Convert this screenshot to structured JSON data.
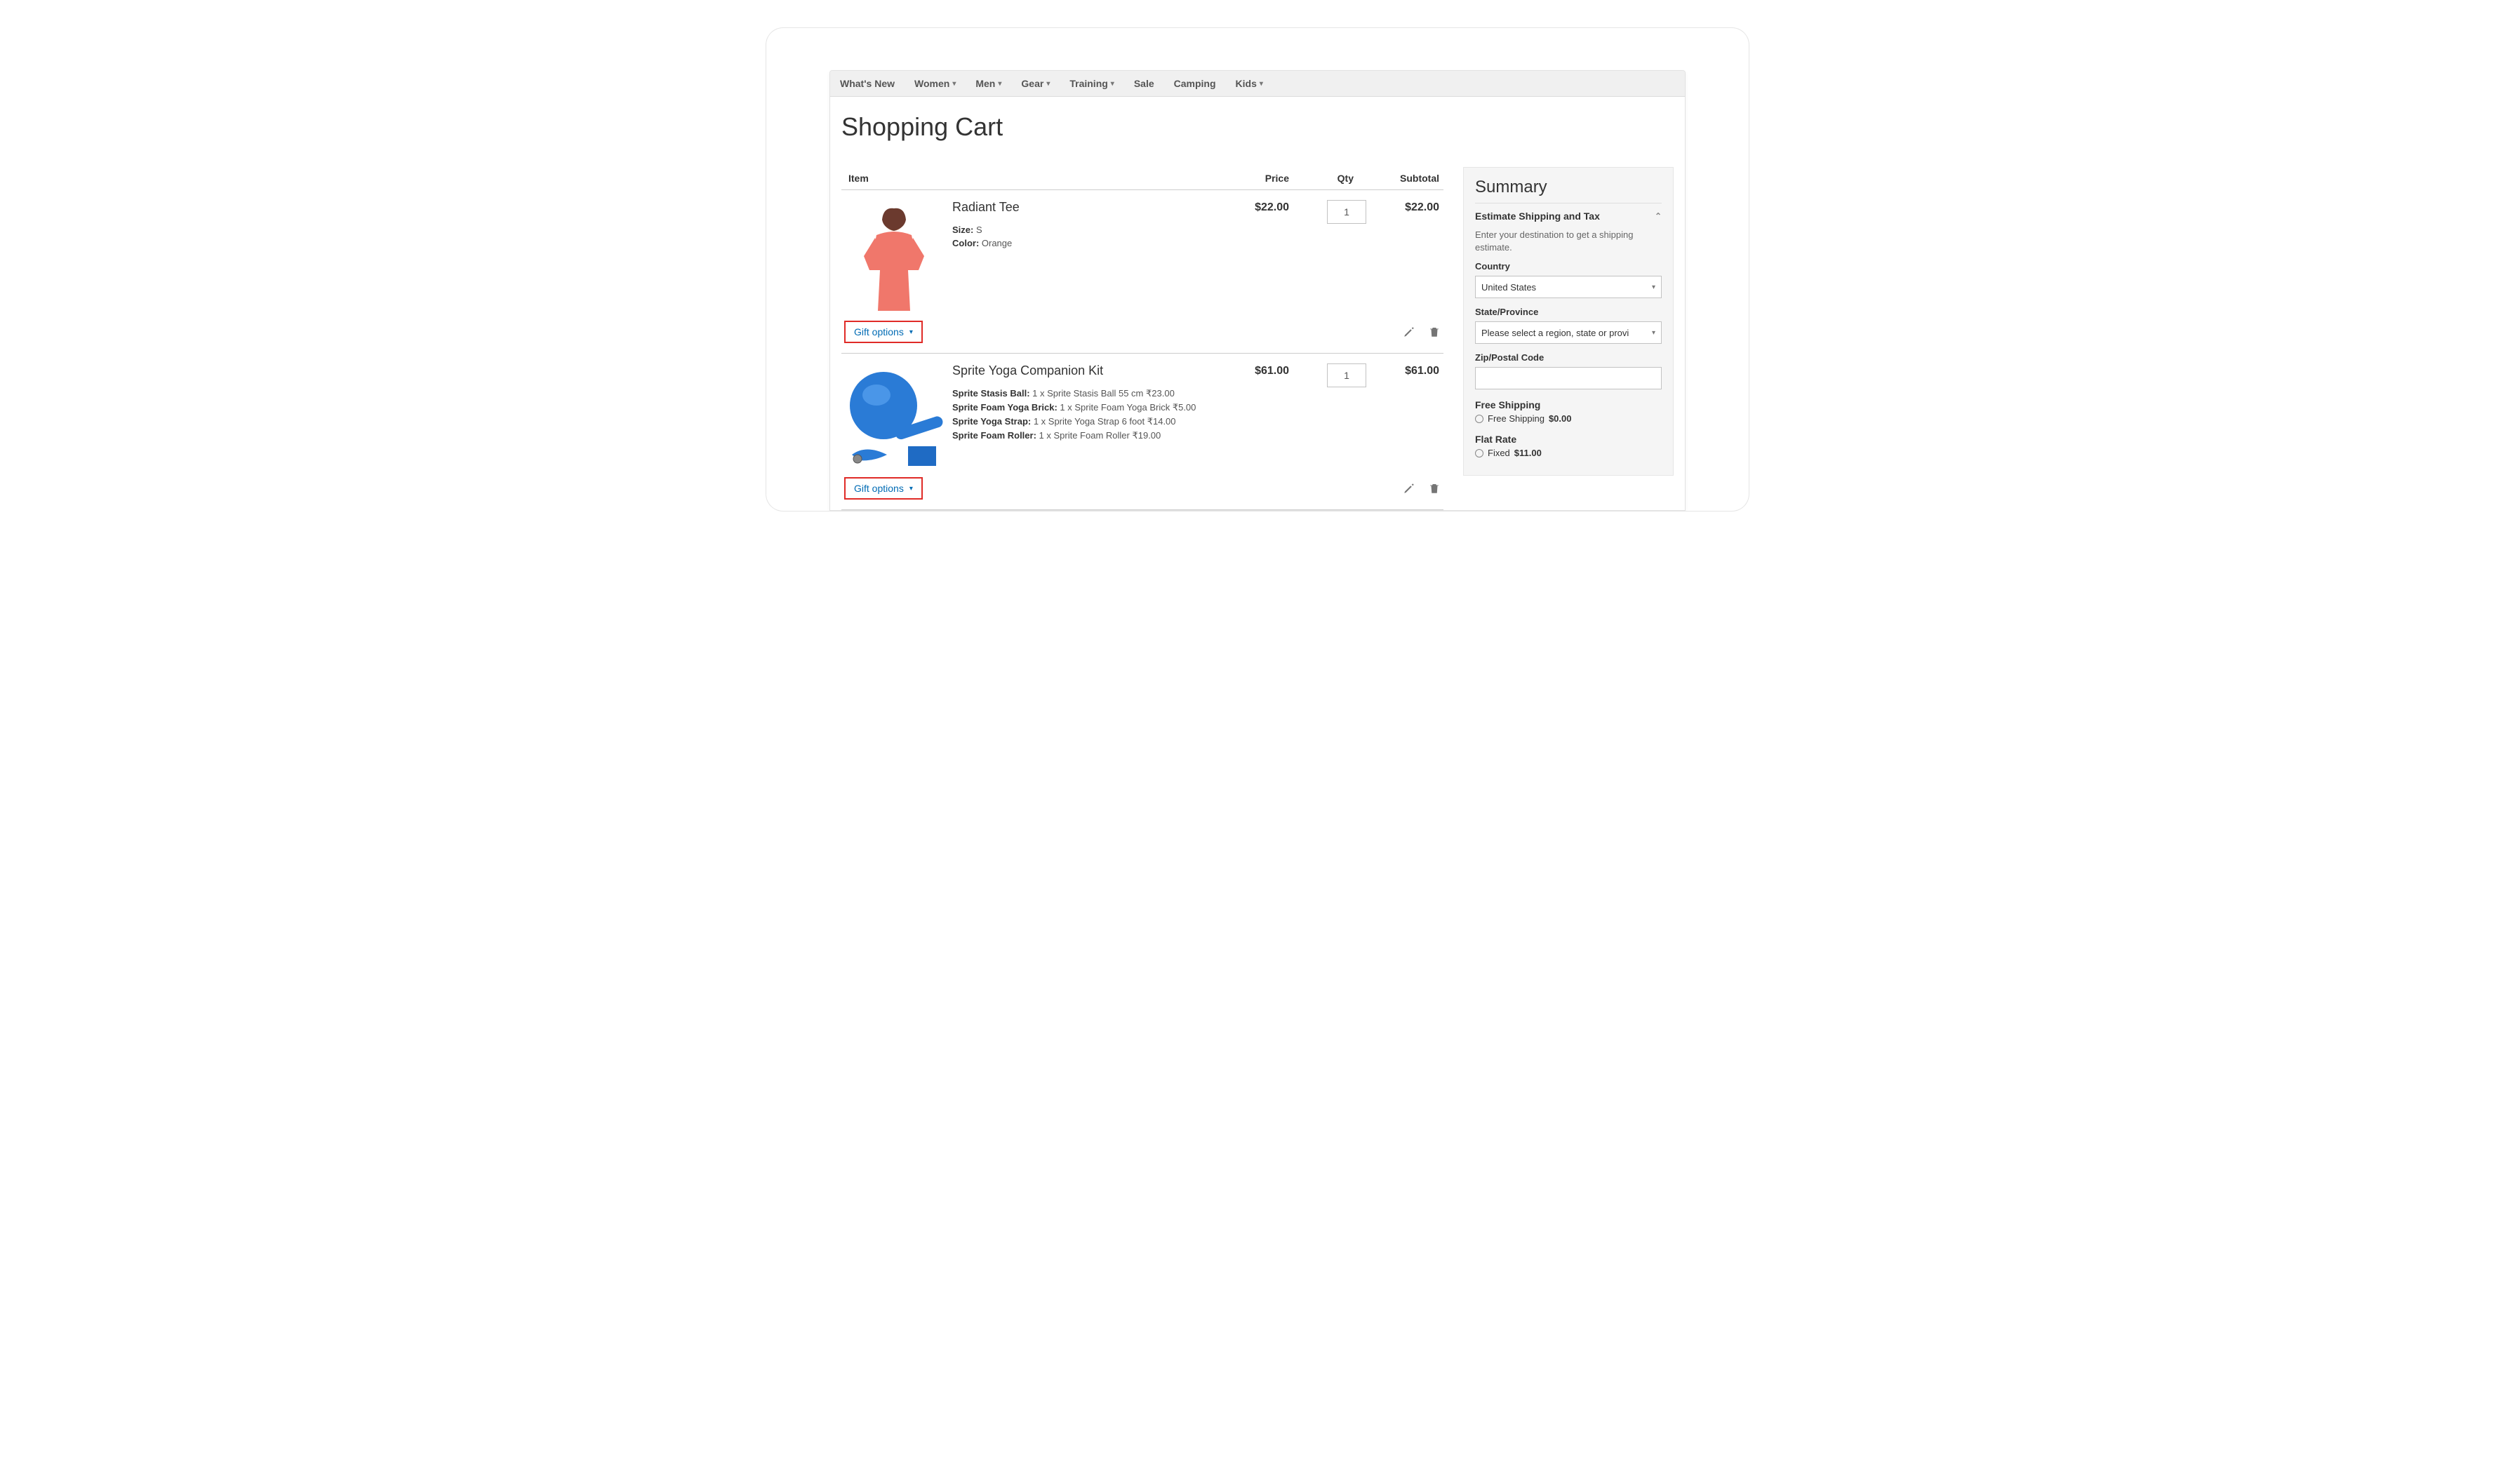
{
  "nav": {
    "items": [
      {
        "label": "What's New",
        "dropdown": false
      },
      {
        "label": "Women",
        "dropdown": true
      },
      {
        "label": "Men",
        "dropdown": true
      },
      {
        "label": "Gear",
        "dropdown": true
      },
      {
        "label": "Training",
        "dropdown": true
      },
      {
        "label": "Sale",
        "dropdown": false
      },
      {
        "label": "Camping",
        "dropdown": false
      },
      {
        "label": "Kids",
        "dropdown": true
      }
    ]
  },
  "page_title": "Shopping Cart",
  "table": {
    "headers": {
      "item": "Item",
      "price": "Price",
      "qty": "Qty",
      "subtotal": "Subtotal"
    }
  },
  "items": [
    {
      "name": "Radiant Tee",
      "price": "$22.00",
      "qty": "1",
      "subtotal": "$22.00",
      "attrs": [
        {
          "label": "Size:",
          "value": "S"
        },
        {
          "label": "Color:",
          "value": "Orange"
        }
      ],
      "gift_label": "Gift options"
    },
    {
      "name": "Sprite Yoga Companion Kit",
      "price": "$61.00",
      "qty": "1",
      "subtotal": "$61.00",
      "attrs": [
        {
          "label": "Sprite Stasis Ball:",
          "value": "1 x Sprite Stasis Ball 55 cm ₹23.00"
        },
        {
          "label": "Sprite Foam Yoga Brick:",
          "value": "1 x Sprite Foam Yoga Brick ₹5.00"
        },
        {
          "label": "Sprite Yoga Strap:",
          "value": "1 x Sprite Yoga Strap 6 foot ₹14.00"
        },
        {
          "label": "Sprite Foam Roller:",
          "value": "1 x Sprite Foam Roller ₹19.00"
        }
      ],
      "gift_label": "Gift options"
    }
  ],
  "summary": {
    "title": "Summary",
    "estimate_title": "Estimate Shipping and Tax",
    "estimate_desc": "Enter your destination to get a shipping estimate.",
    "country_label": "Country",
    "country_value": "United States",
    "state_label": "State/Province",
    "state_value": "Please select a region, state or provi",
    "zip_label": "Zip/Postal Code",
    "zip_value": "",
    "methods": [
      {
        "title": "Free Shipping",
        "option_label": "Free Shipping",
        "option_price": "$0.00"
      },
      {
        "title": "Flat Rate",
        "option_label": "Fixed",
        "option_price": "$11.00"
      }
    ]
  }
}
